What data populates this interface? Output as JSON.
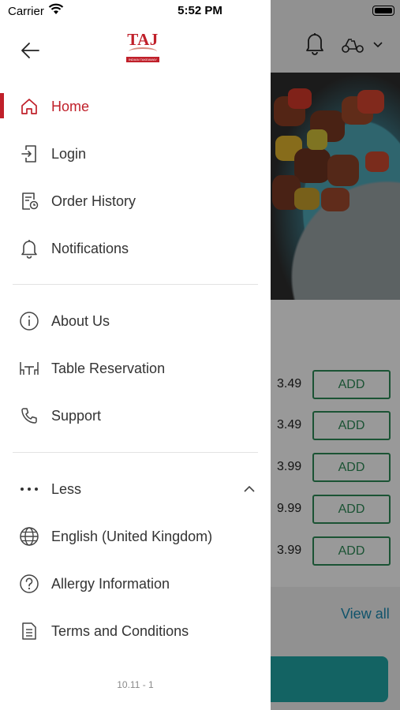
{
  "status_bar": {
    "carrier": "Carrier",
    "time": "5:52 PM"
  },
  "brand": {
    "logo_text": "TAJ",
    "logo_tagline": "INDIAN TAKEAWAY",
    "accent_color": "#c0202a"
  },
  "menu": {
    "primary": [
      {
        "label": "Home",
        "icon": "home-icon",
        "active": true
      },
      {
        "label": "Login",
        "icon": "login-icon"
      },
      {
        "label": "Order History",
        "icon": "order-history-icon"
      },
      {
        "label": "Notifications",
        "icon": "bell-icon"
      }
    ],
    "secondary": [
      {
        "label": "About Us",
        "icon": "info-icon"
      },
      {
        "label": "Table Reservation",
        "icon": "table-icon"
      },
      {
        "label": "Support",
        "icon": "phone-icon"
      }
    ],
    "tertiary": [
      {
        "label": "Less",
        "icon": "more-dots-icon"
      },
      {
        "label": "English (United Kingdom)",
        "icon": "globe-icon"
      },
      {
        "label": "Allergy Information",
        "icon": "question-icon"
      },
      {
        "label": "Terms and Conditions",
        "icon": "document-icon"
      }
    ]
  },
  "version": "10.11 - 1",
  "background": {
    "prices": [
      "3.49",
      "3.49",
      "3.99",
      "9.99",
      "3.99"
    ],
    "add_label": "ADD",
    "view_all": "View all",
    "add_color": "#2e8b57",
    "link_color": "#1b8bb3"
  }
}
